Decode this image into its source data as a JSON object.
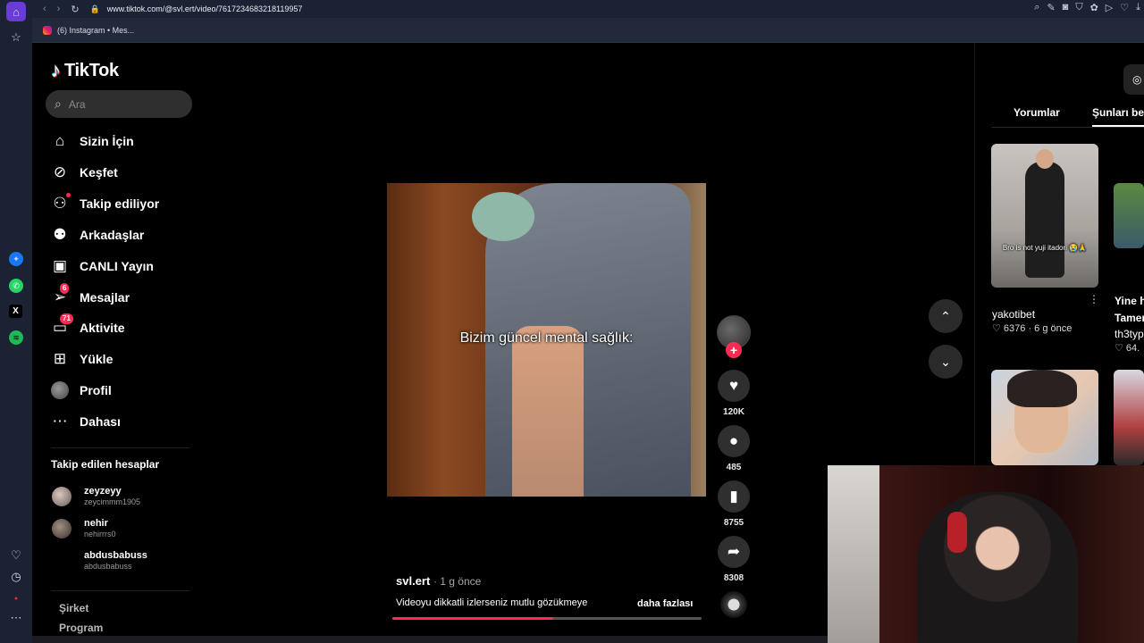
{
  "browser": {
    "url": "www.tiktok.com/@svl.ert/video/7617234683218119957",
    "bookmark_label": "(6) Instagram • Mes..."
  },
  "brand": {
    "logo_text": "TikTok"
  },
  "search": {
    "placeholder": "Ara"
  },
  "nav": {
    "items": [
      {
        "label": "Sizin İçin",
        "icon": "home-icon"
      },
      {
        "label": "Keşfet",
        "icon": "compass-icon"
      },
      {
        "label": "Takip ediliyor",
        "icon": "following-icon"
      },
      {
        "label": "Arkadaşlar",
        "icon": "friends-icon"
      },
      {
        "label": "CANLI Yayın",
        "icon": "live-icon"
      },
      {
        "label": "Mesajlar",
        "icon": "messages-icon",
        "badge": "6"
      },
      {
        "label": "Aktivite",
        "icon": "activity-icon",
        "badge": "71"
      },
      {
        "label": "Yükle",
        "icon": "upload-icon"
      },
      {
        "label": "Profil",
        "icon": "profile-avatar"
      },
      {
        "label": "Dahası",
        "icon": "more-icon"
      }
    ]
  },
  "following": {
    "title": "Takip edilen hesaplar",
    "accounts": [
      {
        "name": "zeyzeyy",
        "handle": "zeycimmm1905"
      },
      {
        "name": "nehir",
        "handle": "nehirrrs0"
      },
      {
        "name": "abdusbabuss",
        "handle": "abdusbabuss"
      }
    ]
  },
  "footer": {
    "links": [
      "Şirket",
      "Program"
    ]
  },
  "video": {
    "caption_overlay": "Bizim güncel mental sağlık:",
    "author": "svl.ert",
    "time": "· 1 g önce",
    "description": "Videoyu dikkatli izlerseniz mutlu gözükmeye",
    "more_label": "daha fazlası",
    "progress": 0.52
  },
  "actions": {
    "follow_symbol": "+",
    "likes": "120K",
    "comments": "485",
    "saves": "8755",
    "shares": "8308"
  },
  "right_panel": {
    "tabs": [
      "Yorumlar",
      "Şunları beğen"
    ],
    "active_tab": 1,
    "cards": [
      {
        "caption": "Bro is not yuji itadori 😭🙏",
        "user": "yakotibet",
        "stats": "♡ 6376 · 6 g önce"
      },
      {
        "title_line1": "Yine h",
        "title_line2": "Tamer",
        "user": "th3typ",
        "stats": "♡ 64."
      }
    ]
  },
  "colors": {
    "accent": "#fe2c55",
    "background": "#000000",
    "sidebar_rail": "#1b2233"
  }
}
